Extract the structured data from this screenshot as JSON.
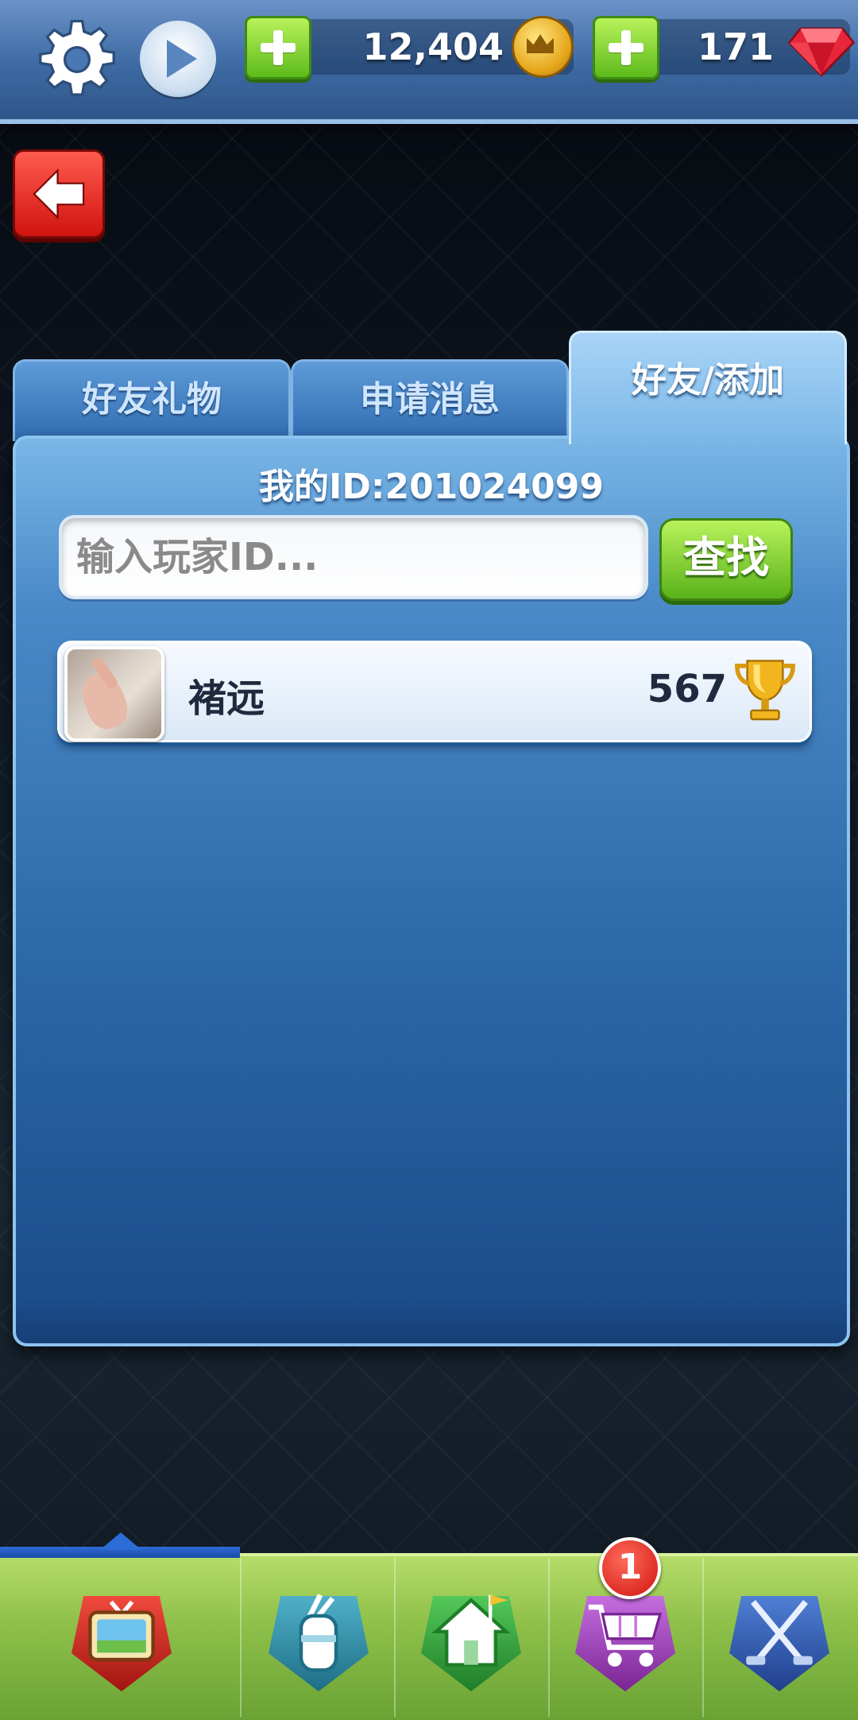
{
  "header": {
    "coins": "12,404",
    "gems": "171"
  },
  "tabs": [
    {
      "label": "好友礼物",
      "active": false
    },
    {
      "label": "申请消息",
      "active": false
    },
    {
      "label": "好友/添加",
      "active": true
    }
  ],
  "panel": {
    "my_id": "我的ID:201024099",
    "search_placeholder": "输入玩家ID...",
    "search_value": "",
    "find_label": "查找",
    "friends": [
      {
        "name": "褚远",
        "score": "567"
      }
    ]
  },
  "bottom_nav": {
    "items": [
      "tv-icon",
      "golf-bag-icon",
      "home-icon",
      "shop-cart-icon",
      "crossed-clubs-icon"
    ],
    "active": "tv-icon",
    "shop_badge": "1"
  },
  "colors": {
    "accent_blue": "#2e6aaa",
    "accent_green": "#59b21a",
    "back_red": "#d0140f"
  }
}
